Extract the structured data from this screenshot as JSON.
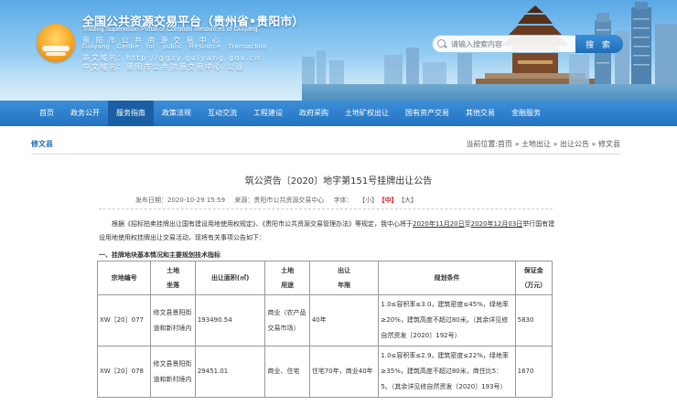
{
  "header": {
    "title_cn": "全国公共资源交易平台（贵州省•贵阳市）",
    "title_en": "Trading Supervision Portal of Common Resources of Guiyang",
    "center_cn": "贵阳市公共资源交易中心",
    "center_en": "Guiyang Centre for public Resource Transaction",
    "domain_en": "英文域名：http://ggzy.guiyang.gov.cn",
    "domain_cn": "中文域名：贵阳市公共资源交易中心.公益"
  },
  "search": {
    "placeholder": "请输入搜索内容",
    "button_label": "搜 索"
  },
  "nav": {
    "items": [
      {
        "label": "首页"
      },
      {
        "label": "政务公开"
      },
      {
        "label": "服务指南"
      },
      {
        "label": "政策法规"
      },
      {
        "label": "互动交流"
      },
      {
        "label": "工程建设"
      },
      {
        "label": "政府采购"
      },
      {
        "label": "土地矿权出让"
      },
      {
        "label": "国有资产交易"
      },
      {
        "label": "其他交易"
      },
      {
        "label": "金融服务"
      }
    ],
    "active_index": 2
  },
  "breadcrumb": {
    "section": "修文县",
    "path": "当前位置:首页 » 土地出让 » 出让公告 » 修文县"
  },
  "article": {
    "title": "筑公资告〔2020〕地字第151号挂牌出让公告",
    "publish_date": "发布日期：2020-10-29 15:59",
    "source": "来源：贵阳市公共资源交易中心",
    "font_label": "字体：",
    "font_small": "【小】",
    "font_medium": "【中】",
    "font_large": "【大】",
    "intro_1": "根据《招标拍卖挂牌出让国有建设用地使用权规定》、《贵阳市公共资源交易管理办法》等规定，我中心将于",
    "date_start": "2020年11月20日",
    "intro_to": "至",
    "date_end": "2020年12月03日",
    "intro_2": "举行国有建设用地使用权挂牌出让交易活动，现将有关事项公告如下：",
    "section_1": "一、挂牌地块基本情况和主要规划技术指标"
  },
  "table": {
    "headers": [
      "宗地编号",
      "土地\n坐落",
      "出让面积(㎡)",
      "土地\n用途",
      "出让\n年限",
      "规划条件",
      "保证金\n（万元）"
    ],
    "rows": [
      [
        "XW［20］077",
        "修文县景阳街道和新村境内",
        "193490.54",
        "商业（农产品交易市场）",
        "40年",
        "1.0≤容积率≤3.0，建筑密度≤45%，绿地率≥20%，建筑高度不超过80米。（其余详见修自然资发〔2020〕192号）",
        "5830"
      ],
      [
        "XW［20］078",
        "修文县景阳街道和新村境内",
        "29451.01",
        "商业、住宅",
        "住宅70年，商业40年",
        "1.0≤容积率≤2.9，建筑密度≤22%，绿地率≥35%，建筑高度不超过80米，商住比5：5。（其余详见修自然资发〔2020〕193号）",
        "1670"
      ]
    ]
  },
  "colors": {
    "nav_blue": "#2272c1",
    "nav_active": "#1a5ea3",
    "link_blue": "#1f6db8",
    "font_highlight": "#e21a1a"
  }
}
